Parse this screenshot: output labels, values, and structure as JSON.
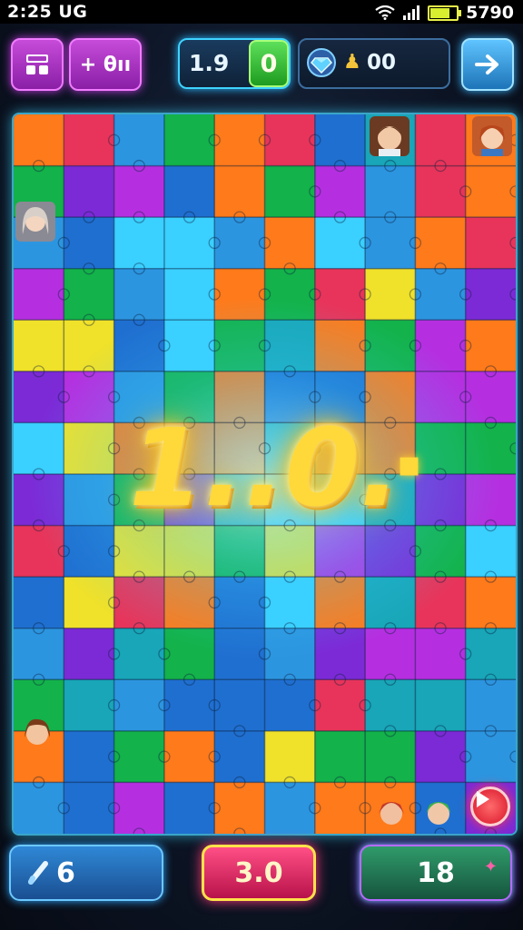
{
  "status_bar": {
    "time": "2:25 UG",
    "battery_text": "5790",
    "battery_level": 0.8
  },
  "toolbar": {
    "menu_icon": "grid-icon",
    "add_label": "+ θıı",
    "score_value": "1.9",
    "score_badge": "0",
    "gem_icon": "diamond-icon",
    "key_icon": "key-icon",
    "gems_value": "00",
    "next_icon": "arrow-right-icon"
  },
  "board": {
    "big_score": "1..0.",
    "big_suffix": "▪",
    "play_icon": "play-icon",
    "colors": [
      "#1f6fd0",
      "#2c95e0",
      "#13b24a",
      "#f0e12a",
      "#ff7a1a",
      "#e8345a",
      "#b52fe0",
      "#7c2ad6",
      "#18a6b8",
      "#3ad0ff"
    ]
  },
  "bottom_bar": {
    "hint_icon": "pencil-icon",
    "hint_value": "6",
    "score_value": "3.0",
    "moves_value": "18",
    "moves_icon": "star-icon"
  }
}
